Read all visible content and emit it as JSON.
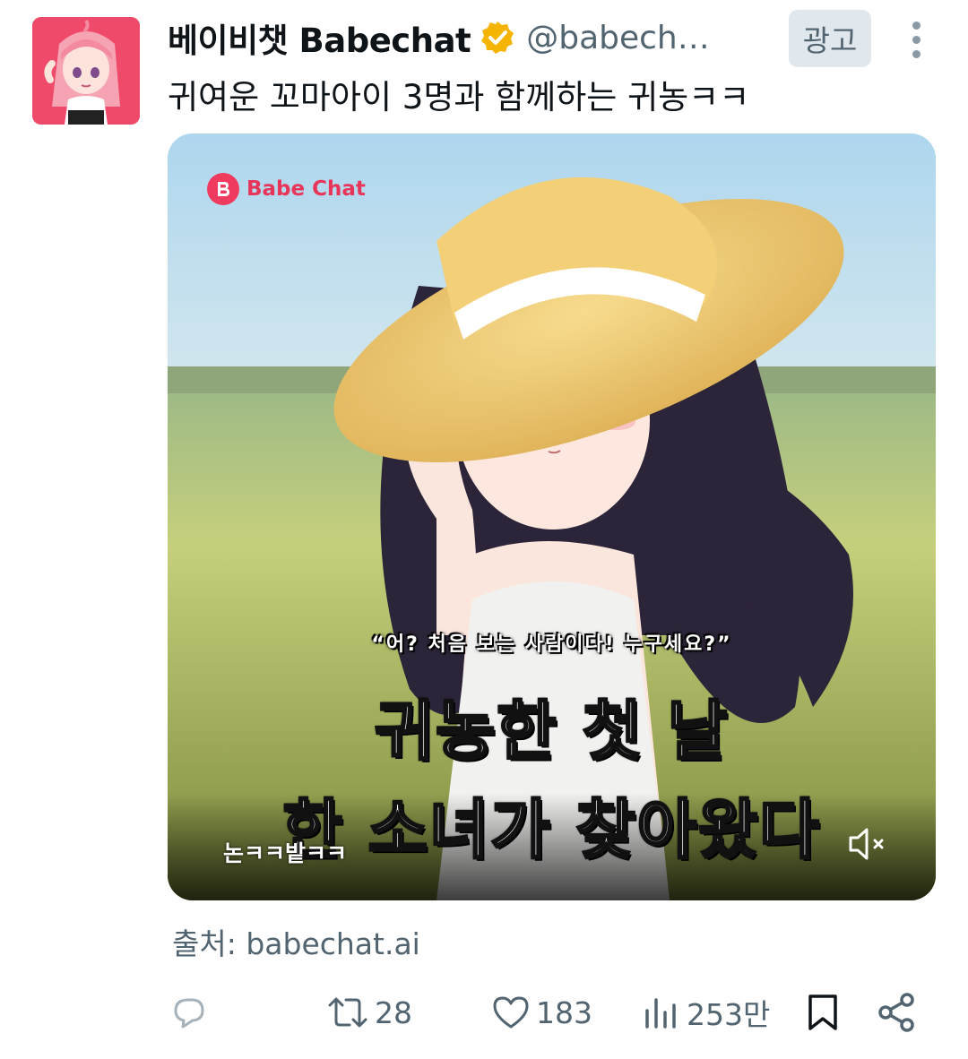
{
  "author": {
    "display_name": "베이비챗 Babechat",
    "handle": "@babech…",
    "verified_icon": "verified-badge-icon",
    "verified_color": "#f4b400"
  },
  "ad_badge": "광고",
  "tweet_text": "귀여운 꼬마아이 3명과 함께하는 귀농ㅋㅋ",
  "media": {
    "brand": "Babe Chat",
    "brand_color": "#ef3b5e",
    "quote": "“어? 처음 보는 사람이다! 누구세요?”",
    "title_line1": "귀농한 첫 날",
    "title_line2": "한 소녀가 찾아왔다",
    "caption": "논ㅋㅋ밭ㅋㅋ",
    "mute_icon": "speaker-muted-icon"
  },
  "source": "출처: babechat.ai",
  "actions": {
    "reply_icon": "reply-icon",
    "retweet_icon": "retweet-icon",
    "retweet_count": "28",
    "like_icon": "heart-icon",
    "like_count": "183",
    "views_icon": "views-chart-icon",
    "views_count": "253만",
    "bookmark_icon": "bookmark-icon",
    "share_icon": "share-icon"
  }
}
